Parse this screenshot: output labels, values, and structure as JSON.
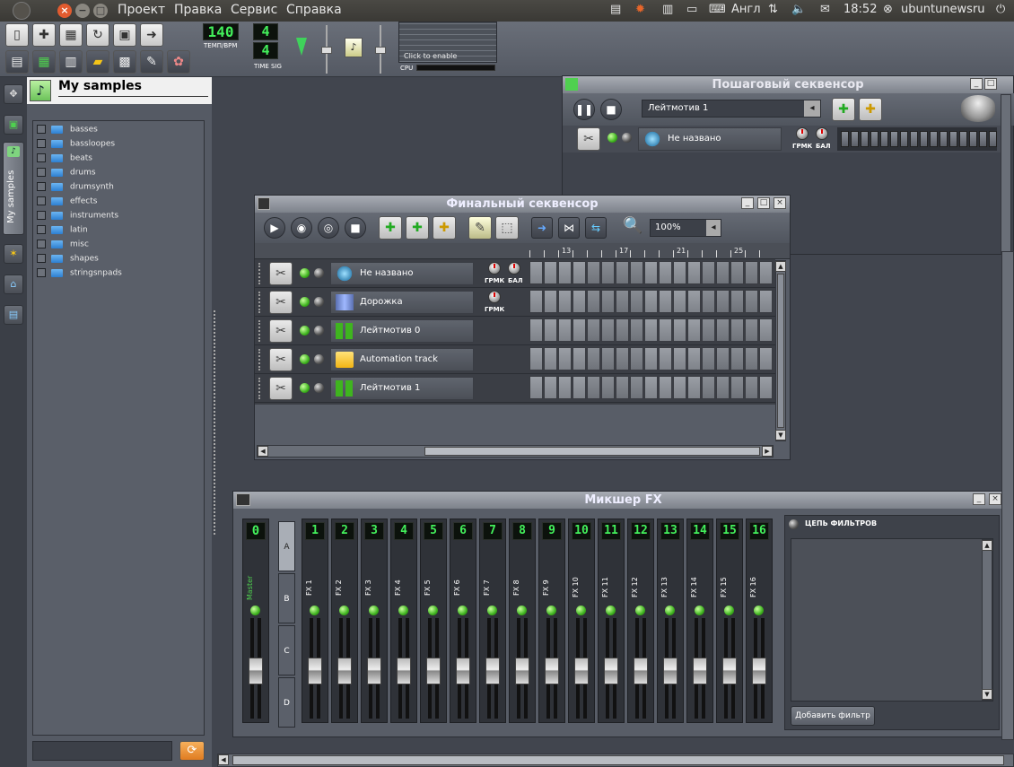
{
  "topbar": {
    "menu": [
      "Проект",
      "Правка",
      "Сервис",
      "Справка"
    ],
    "keyboard": "Англ",
    "time": "18:52",
    "user": "ubuntunewsru"
  },
  "toolbar": {
    "tempo_value": "140",
    "tempo_label": "ТЕМП/BPM",
    "timesig_num": "4",
    "timesig_den": "4",
    "timesig_label": "TIME SIG",
    "graph_hint": "Click to enable",
    "cpu_label": "CPU"
  },
  "side": {
    "tab_label": "My samples",
    "panel_title": "My samples",
    "folders": [
      "basses",
      "bassloopes",
      "beats",
      "drums",
      "drumsynth",
      "effects",
      "instruments",
      "latin",
      "misc",
      "shapes",
      "stringsnpads"
    ]
  },
  "step_seq": {
    "title": "Пошаговый секвенсор",
    "pattern": "Лейтмотив 1",
    "track_name": "Не названо",
    "knob_vol": "ГРМК",
    "knob_pan": "БАЛ"
  },
  "song_editor": {
    "title": "Финальный секвенсор",
    "zoom": "100%",
    "bar_labels": [
      "13",
      "17",
      "21",
      "25"
    ],
    "knob_vol": "ГРМК",
    "knob_pan": "БАЛ",
    "tracks": [
      {
        "name": "Не названо",
        "icon": "instrument-icon",
        "knobs": 2
      },
      {
        "name": "Дорожка",
        "icon": "sample-track-icon",
        "knobs": 1
      },
      {
        "name": "Лейтмотив 0",
        "icon": "bb-track-icon",
        "knobs": 0
      },
      {
        "name": "Automation track",
        "icon": "automation-folder-icon",
        "knobs": 0
      },
      {
        "name": "Лейтмотив 1",
        "icon": "bb-track-icon",
        "knobs": 0
      }
    ]
  },
  "mixer": {
    "title": "Микшер FX",
    "master_num": "0",
    "master_name": "Master",
    "banks": [
      "A",
      "B",
      "C",
      "D"
    ],
    "channels": [
      "1",
      "2",
      "3",
      "4",
      "5",
      "6",
      "7",
      "8",
      "9",
      "10",
      "11",
      "12",
      "13",
      "14",
      "15",
      "16"
    ],
    "channel_prefix": "FX",
    "effects_title": "ЦЕПЬ ФИЛЬТРОВ",
    "add_effect": "Добавить фильтр"
  }
}
